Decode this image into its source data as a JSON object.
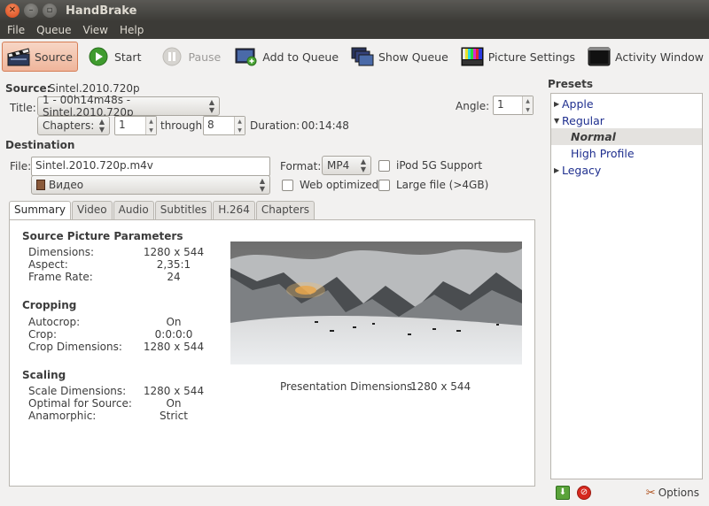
{
  "window": {
    "title": "HandBrake"
  },
  "menu": {
    "items": [
      "File",
      "Queue",
      "View",
      "Help"
    ]
  },
  "toolbar": {
    "source": "Source",
    "start": "Start",
    "pause": "Pause",
    "add_to_queue": "Add to Queue",
    "show_queue": "Show Queue",
    "picture_settings": "Picture Settings",
    "activity_window": "Activity Window"
  },
  "source": {
    "label": "Source:",
    "value": "Sintel.2010.720p"
  },
  "title_row": {
    "label": "Title:",
    "value": "1 - 00h14m48s - Sintel.2010.720p",
    "angle_label": "Angle:",
    "angle_value": "1"
  },
  "chapters": {
    "mode": "Chapters:",
    "from": "1",
    "through_label": "through",
    "to": "8",
    "duration_label": "Duration:",
    "duration_value": "00:14:48"
  },
  "destination": {
    "heading": "Destination",
    "file_label": "File:",
    "file_value": "Sintel.2010.720p.m4v",
    "format_label": "Format:",
    "format_value": "MP4",
    "ipod": "iPod 5G Support",
    "profile": "Видео",
    "web_optimized": "Web optimized",
    "large_file": "Large file (>4GB)"
  },
  "tabs": [
    "Summary",
    "Video",
    "Audio",
    "Subtitles",
    "H.264",
    "Chapters"
  ],
  "summary": {
    "source_params": {
      "heading": "Source Picture Parameters",
      "rows": [
        {
          "label": "Dimensions:",
          "value": "1280 x 544"
        },
        {
          "label": "Aspect:",
          "value": "2,35:1"
        },
        {
          "label": "Frame Rate:",
          "value": "24"
        }
      ]
    },
    "cropping": {
      "heading": "Cropping",
      "rows": [
        {
          "label": "Autocrop:",
          "value": "On"
        },
        {
          "label": "Crop:",
          "value": "0:0:0:0"
        },
        {
          "label": "Crop Dimensions:",
          "value": "1280 x 544"
        }
      ]
    },
    "scaling": {
      "heading": "Scaling",
      "rows": [
        {
          "label": "Scale Dimensions:",
          "value": "1280 x 544"
        },
        {
          "label": "Optimal for Source:",
          "value": "On"
        },
        {
          "label": "Anamorphic:",
          "value": "Strict"
        }
      ]
    },
    "presentation_label": "Presentation Dimensions:",
    "presentation_value": "1280 x 544"
  },
  "presets": {
    "heading": "Presets",
    "items": [
      {
        "label": "Apple",
        "level": 0,
        "expanded": false
      },
      {
        "label": "Regular",
        "level": 0,
        "expanded": true
      },
      {
        "label": "Normal",
        "level": 1,
        "selected": true
      },
      {
        "label": "High Profile",
        "level": 1
      },
      {
        "label": "Legacy",
        "level": 0,
        "expanded": false
      }
    ],
    "options": "Options"
  },
  "colors": {
    "titlebar": "#3c3b37",
    "close": "#e0562b",
    "link": "#1f2f8f",
    "active_button": "#efb59b"
  }
}
